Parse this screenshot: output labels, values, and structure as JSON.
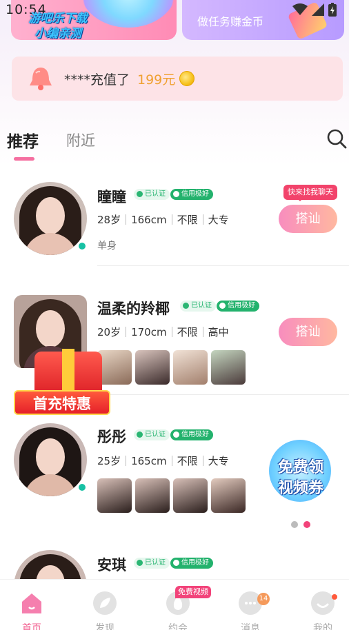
{
  "status_bar": {
    "time": "10:54"
  },
  "watermark": {
    "line1": "游吧乐下载",
    "line2": "小编亲测"
  },
  "banners": {
    "right_text": "做任务赚金币"
  },
  "recharge_notice": {
    "text": "****充值了",
    "amount": "199元"
  },
  "tabs": [
    {
      "label": "推荐",
      "active": true
    },
    {
      "label": "附近",
      "active": false
    }
  ],
  "profiles": [
    {
      "name": "瞳瞳",
      "badges": [
        "已认证",
        "信用极好"
      ],
      "age": "28岁",
      "height": "166cm",
      "location": "不限",
      "education": "大专",
      "status": "单身",
      "tip": "快来找我聊天",
      "action": "搭讪",
      "online": true
    },
    {
      "name": "温柔的羚椰",
      "badges": [
        "已认证",
        "信用极好"
      ],
      "age": "20岁",
      "height": "170cm",
      "location": "不限",
      "education": "高中",
      "action": "搭讪",
      "photo_count": 4
    },
    {
      "name": "彤彤",
      "badges": [
        "已认证",
        "信用极好"
      ],
      "age": "25岁",
      "height": "165cm",
      "location": "不限",
      "education": "大专",
      "photo_count": 4,
      "online": true
    },
    {
      "name": "安琪",
      "badges": [
        "已认证",
        "信用极好"
      ]
    }
  ],
  "promos": {
    "recharge_label": "首充特惠",
    "video_line1": "免费领",
    "video_line2": "视频券"
  },
  "bottom_nav": {
    "items": [
      {
        "label": "首页",
        "icon": "home-icon",
        "active": true
      },
      {
        "label": "发现",
        "icon": "discover-icon",
        "active": false
      },
      {
        "label": "约会",
        "icon": "date-icon",
        "active": false
      },
      {
        "label": "消息",
        "icon": "message-icon",
        "active": false
      },
      {
        "label": "我的",
        "icon": "profile-icon",
        "active": false
      }
    ],
    "free_video_tag": "免费视频",
    "message_count": "14"
  },
  "colors": {
    "accent": "#f25f8f",
    "online": "#17c1a4",
    "coin": "#f7c21c",
    "credit_badge": "#23b26d"
  }
}
